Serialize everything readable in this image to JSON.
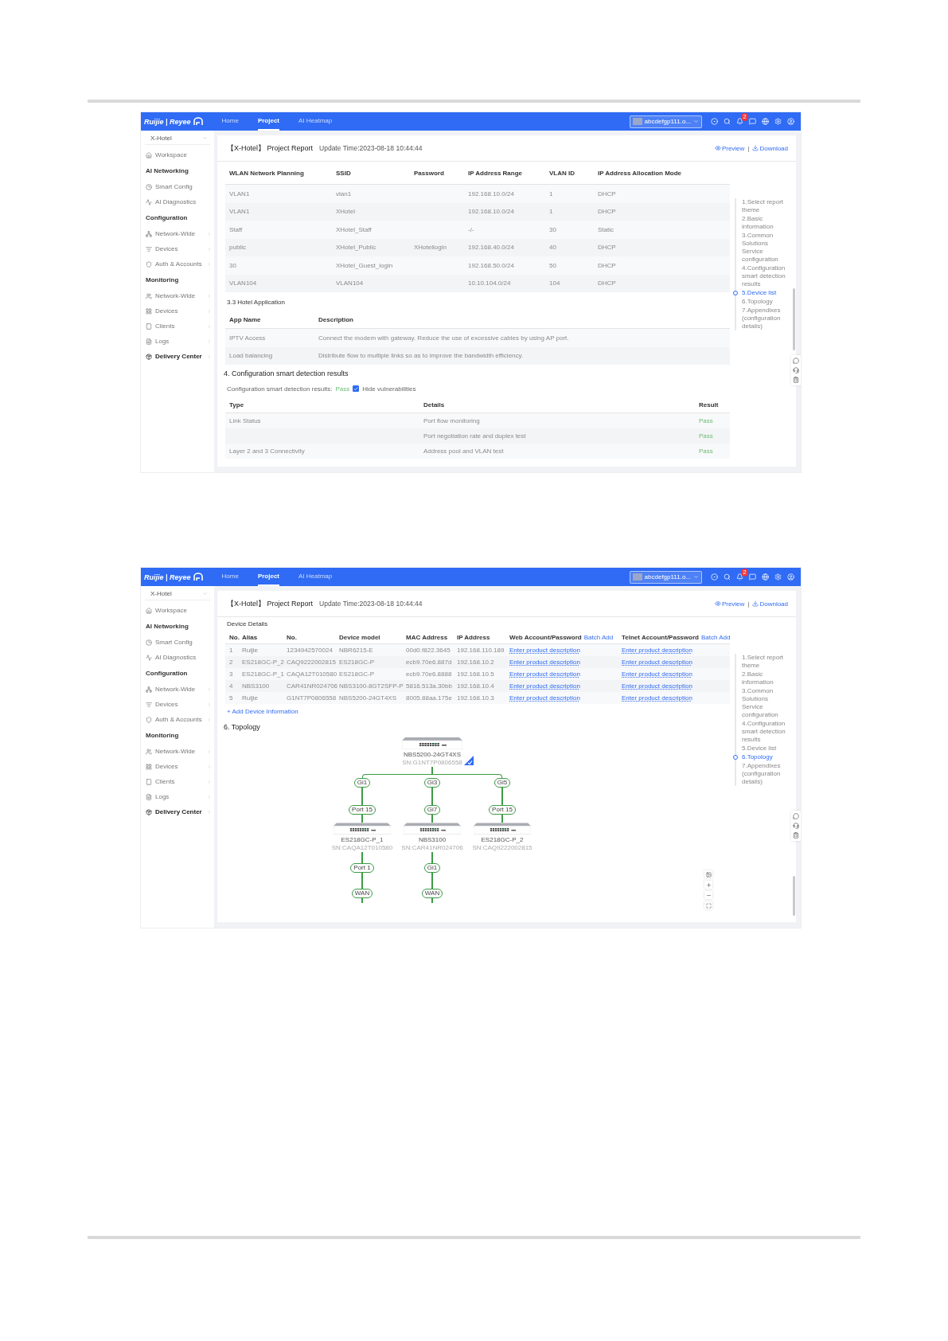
{
  "screens": [
    {
      "logo": "Ruijie | Reyee",
      "nav": [
        {
          "label": "Home",
          "selected": false
        },
        {
          "label": "Project",
          "selected": true
        },
        {
          "label": "AI Heatmap",
          "selected": false
        }
      ],
      "account": "abcdefgp111.o...",
      "notification_count": "2",
      "project": "X-Hotel",
      "sidebar": [
        {
          "kind": "item",
          "label": "Workspace",
          "expandable": false
        },
        {
          "kind": "group",
          "label": "AI Networking"
        },
        {
          "kind": "item",
          "label": "Smart Config",
          "expandable": false
        },
        {
          "kind": "item",
          "label": "AI Diagnostics",
          "expandable": false
        },
        {
          "kind": "group",
          "label": "Configuration"
        },
        {
          "kind": "item",
          "label": "Network-Wide",
          "expandable": true
        },
        {
          "kind": "item",
          "label": "Devices",
          "expandable": true
        },
        {
          "kind": "item",
          "label": "Auth & Accounts",
          "expandable": true
        },
        {
          "kind": "group",
          "label": "Monitoring"
        },
        {
          "kind": "item",
          "label": "Network-Wide",
          "expandable": true
        },
        {
          "kind": "item",
          "label": "Devices",
          "expandable": true
        },
        {
          "kind": "item",
          "label": "Clients",
          "expandable": true
        },
        {
          "kind": "item",
          "label": "Logs",
          "expandable": true
        },
        {
          "kind": "section",
          "label": "Delivery Center",
          "expandable": true
        }
      ],
      "report": {
        "title": "【X-Hotel】 Project Report",
        "update_time": "Update Time:2023-08-18 10:44:44",
        "actions": [
          "Preview",
          "Download"
        ],
        "separator": "|"
      },
      "blocks": [
        {
          "kind": "wlan_table",
          "columns": [
            {
              "label": "WLAN Network Planning",
              "kind": "text"
            },
            {
              "label": "SSID",
              "kind": "text"
            },
            {
              "label": "Password",
              "kind": "text"
            },
            {
              "label": "IP Address Range",
              "kind": "text"
            },
            {
              "label": "VLAN ID",
              "kind": "text"
            },
            {
              "label": "IP Address Allocation Mode",
              "kind": "text"
            }
          ],
          "rows": [
            [
              "VLAN1",
              "vlan1",
              null,
              "192.168.10.0/24",
              "1",
              "DHCP"
            ],
            [
              "VLAN1",
              "XHotel",
              null,
              "192.168.10.0/24",
              "1",
              "DHCP"
            ],
            [
              "Staff",
              "XHotel_Staff",
              null,
              "-/-",
              "30",
              "Static"
            ],
            [
              "public",
              "XHotel_Public",
              "XHotellogin",
              "192.168.40.0/24",
              "40",
              "DHCP"
            ],
            [
              "30",
              "XHotel_Guest_login",
              null,
              "192.168.50.0/24",
              "50",
              "DHCP"
            ],
            [
              "VLAN104",
              "VLAN104",
              null,
              "10.10.104.0/24",
              "104",
              "DHCP"
            ]
          ]
        },
        {
          "kind": "subheading",
          "text": "3.3 Hotel Application"
        },
        {
          "kind": "app_table",
          "columns": [
            {
              "label": "App Name",
              "kind": "text"
            },
            {
              "label": "Description",
              "kind": "text"
            }
          ],
          "rows": [
            [
              "IPTV Access",
              "Connect the modem with gateway. Reduce the use of excessive cables by using AP port."
            ],
            [
              "Load balancing",
              "Distribute flow to multiple links so as to improve the bandwidth efficiency."
            ]
          ]
        },
        {
          "kind": "heading",
          "text": "4. Configuration smart detection results"
        },
        {
          "kind": "summary",
          "label": "Configuration smart detection results:",
          "result": "Pass",
          "checkbox": {
            "label": "Hide vulnerabilities",
            "checked": true
          }
        },
        {
          "kind": "check_table",
          "columns": [
            {
              "label": "Type",
              "kind": "text"
            },
            {
              "label": "Details",
              "kind": "text"
            },
            {
              "label": "Result",
              "kind": "status"
            }
          ],
          "rows": [
            [
              "Link Status",
              "Port flow monitoring",
              "Pass"
            ],
            [
              null,
              "Port negotiation rate and duplex test",
              "Pass"
            ],
            [
              "Layer 2 and 3 Connectivity",
              "Address pool and VLAN test",
              "Pass"
            ]
          ]
        }
      ],
      "toc": [
        {
          "label": "1.Select report theme",
          "selected": false
        },
        {
          "label": "2.Basic information",
          "selected": false
        },
        {
          "label": "3.Common Solutions Service configuration",
          "selected": false
        },
        {
          "label": "4.Configuration smart detection results",
          "selected": false
        },
        {
          "label": "5.Device list",
          "selected": true
        },
        {
          "label": "6.Topology",
          "selected": false
        },
        {
          "label": "7.Appendixes (configuration details)",
          "selected": false
        }
      ]
    },
    {
      "logo": "Ruijie | Reyee",
      "nav": [
        {
          "label": "Home",
          "selected": false
        },
        {
          "label": "Project",
          "selected": true
        },
        {
          "label": "AI Heatmap",
          "selected": false
        }
      ],
      "account": "abcdefgp111.o...",
      "notification_count": "2",
      "project": "X-Hotel",
      "sidebar": [
        {
          "kind": "item",
          "label": "Workspace",
          "expandable": false
        },
        {
          "kind": "group",
          "label": "AI Networking"
        },
        {
          "kind": "item",
          "label": "Smart Config",
          "expandable": false
        },
        {
          "kind": "item",
          "label": "AI Diagnostics",
          "expandable": false
        },
        {
          "kind": "group",
          "label": "Configuration"
        },
        {
          "kind": "item",
          "label": "Network-Wide",
          "expandable": true
        },
        {
          "kind": "item",
          "label": "Devices",
          "expandable": true
        },
        {
          "kind": "item",
          "label": "Auth & Accounts",
          "expandable": true
        },
        {
          "kind": "group",
          "label": "Monitoring"
        },
        {
          "kind": "item",
          "label": "Network-Wide",
          "expandable": true
        },
        {
          "kind": "item",
          "label": "Devices",
          "expandable": true
        },
        {
          "kind": "item",
          "label": "Clients",
          "expandable": true
        },
        {
          "kind": "item",
          "label": "Logs",
          "expandable": true
        },
        {
          "kind": "section",
          "label": "Delivery Center",
          "expandable": true
        }
      ],
      "report": {
        "title": "【X-Hotel】 Project Report",
        "update_time": "Update Time:2023-08-18 10:44:44",
        "actions": [
          "Preview",
          "Download"
        ],
        "separator": "|"
      },
      "blocks": [
        {
          "kind": "caption",
          "text": "Device Details"
        },
        {
          "kind": "device_table",
          "columns": [
            {
              "label": "No.",
              "kind": "text"
            },
            {
              "label": "Alias",
              "kind": "text"
            },
            {
              "label": "No.",
              "kind": "text"
            },
            {
              "label": "Device model",
              "kind": "text"
            },
            {
              "label": "MAC Address",
              "kind": "text"
            },
            {
              "label": "IP Address",
              "kind": "text"
            },
            {
              "label": "Web Account/Password",
              "action": "Batch Add",
              "kind": "link"
            },
            {
              "label": "Telnet Account/Password",
              "action": "Batch Add",
              "kind": "link"
            }
          ],
          "rows": [
            [
              "1",
              "Ruijie",
              "1234942570024",
              "NBR6215-E",
              "00d0.f822.3645",
              "192.168.110.189",
              "Enter product description",
              "Enter product description"
            ],
            [
              "2",
              "ES218GC-P_2",
              "CAQ9222002815",
              "ES218GC-P",
              "ecb9.70e6.887d",
              "192.168.10.2",
              "Enter product description",
              "Enter product description"
            ],
            [
              "3",
              "ES218GC-P_1",
              "CAQA12T010580",
              "ES218GC-P",
              "ecb9.70e6.8888",
              "192.168.10.5",
              "Enter product description",
              "Enter product description"
            ],
            [
              "4",
              "NBS3100",
              "CAR41NR024706",
              "NBS3100-8GT2SFP-P",
              "5816.513a.30bb",
              "192.168.10.4",
              "Enter product description",
              "Enter product description"
            ],
            [
              "5",
              "Ruijie",
              "G1NT7P0806558",
              "NBS5200-24GT4XS",
              "8005.88aa.175e",
              "192.168.10.3",
              "Enter product description",
              "Enter product description"
            ]
          ]
        },
        {
          "kind": "add_link",
          "text": "+ Add Device Information"
        },
        {
          "kind": "heading",
          "text": "6. Topology"
        },
        {
          "kind": "topology",
          "root": {
            "model": "NBS5200-24GT4XS",
            "sn": "SN:G1NT7P0806558"
          },
          "children": [
            {
              "uplink": "Gi1",
              "port": "Port 15",
              "model": "ES218GC-P_1",
              "sn": "SN:CAQA12T010580",
              "links": [
                {
                  "port": "Port 1",
                  "peer": "WAN"
                }
              ]
            },
            {
              "uplink": "Gi3",
              "port": "Gi7",
              "model": "NBS3100",
              "sn": "SN:CAR41NR024706",
              "links": [
                {
                  "port": "Gi1",
                  "peer": "WAN"
                }
              ]
            },
            {
              "uplink": "Gi5",
              "port": "Port 15",
              "model": "ES218GC-P_2",
              "sn": "SN:CAQ9222002815"
            }
          ]
        }
      ],
      "toc": [
        {
          "label": "1.Select report theme",
          "selected": false
        },
        {
          "label": "2.Basic information",
          "selected": false
        },
        {
          "label": "3.Common Solutions Service configuration",
          "selected": false
        },
        {
          "label": "4.Configuration smart detection results",
          "selected": false
        },
        {
          "label": "5.Device list",
          "selected": false
        },
        {
          "label": "6.Topology",
          "selected": true
        },
        {
          "label": "7.Appendixes (configuration details)",
          "selected": false
        }
      ]
    }
  ]
}
